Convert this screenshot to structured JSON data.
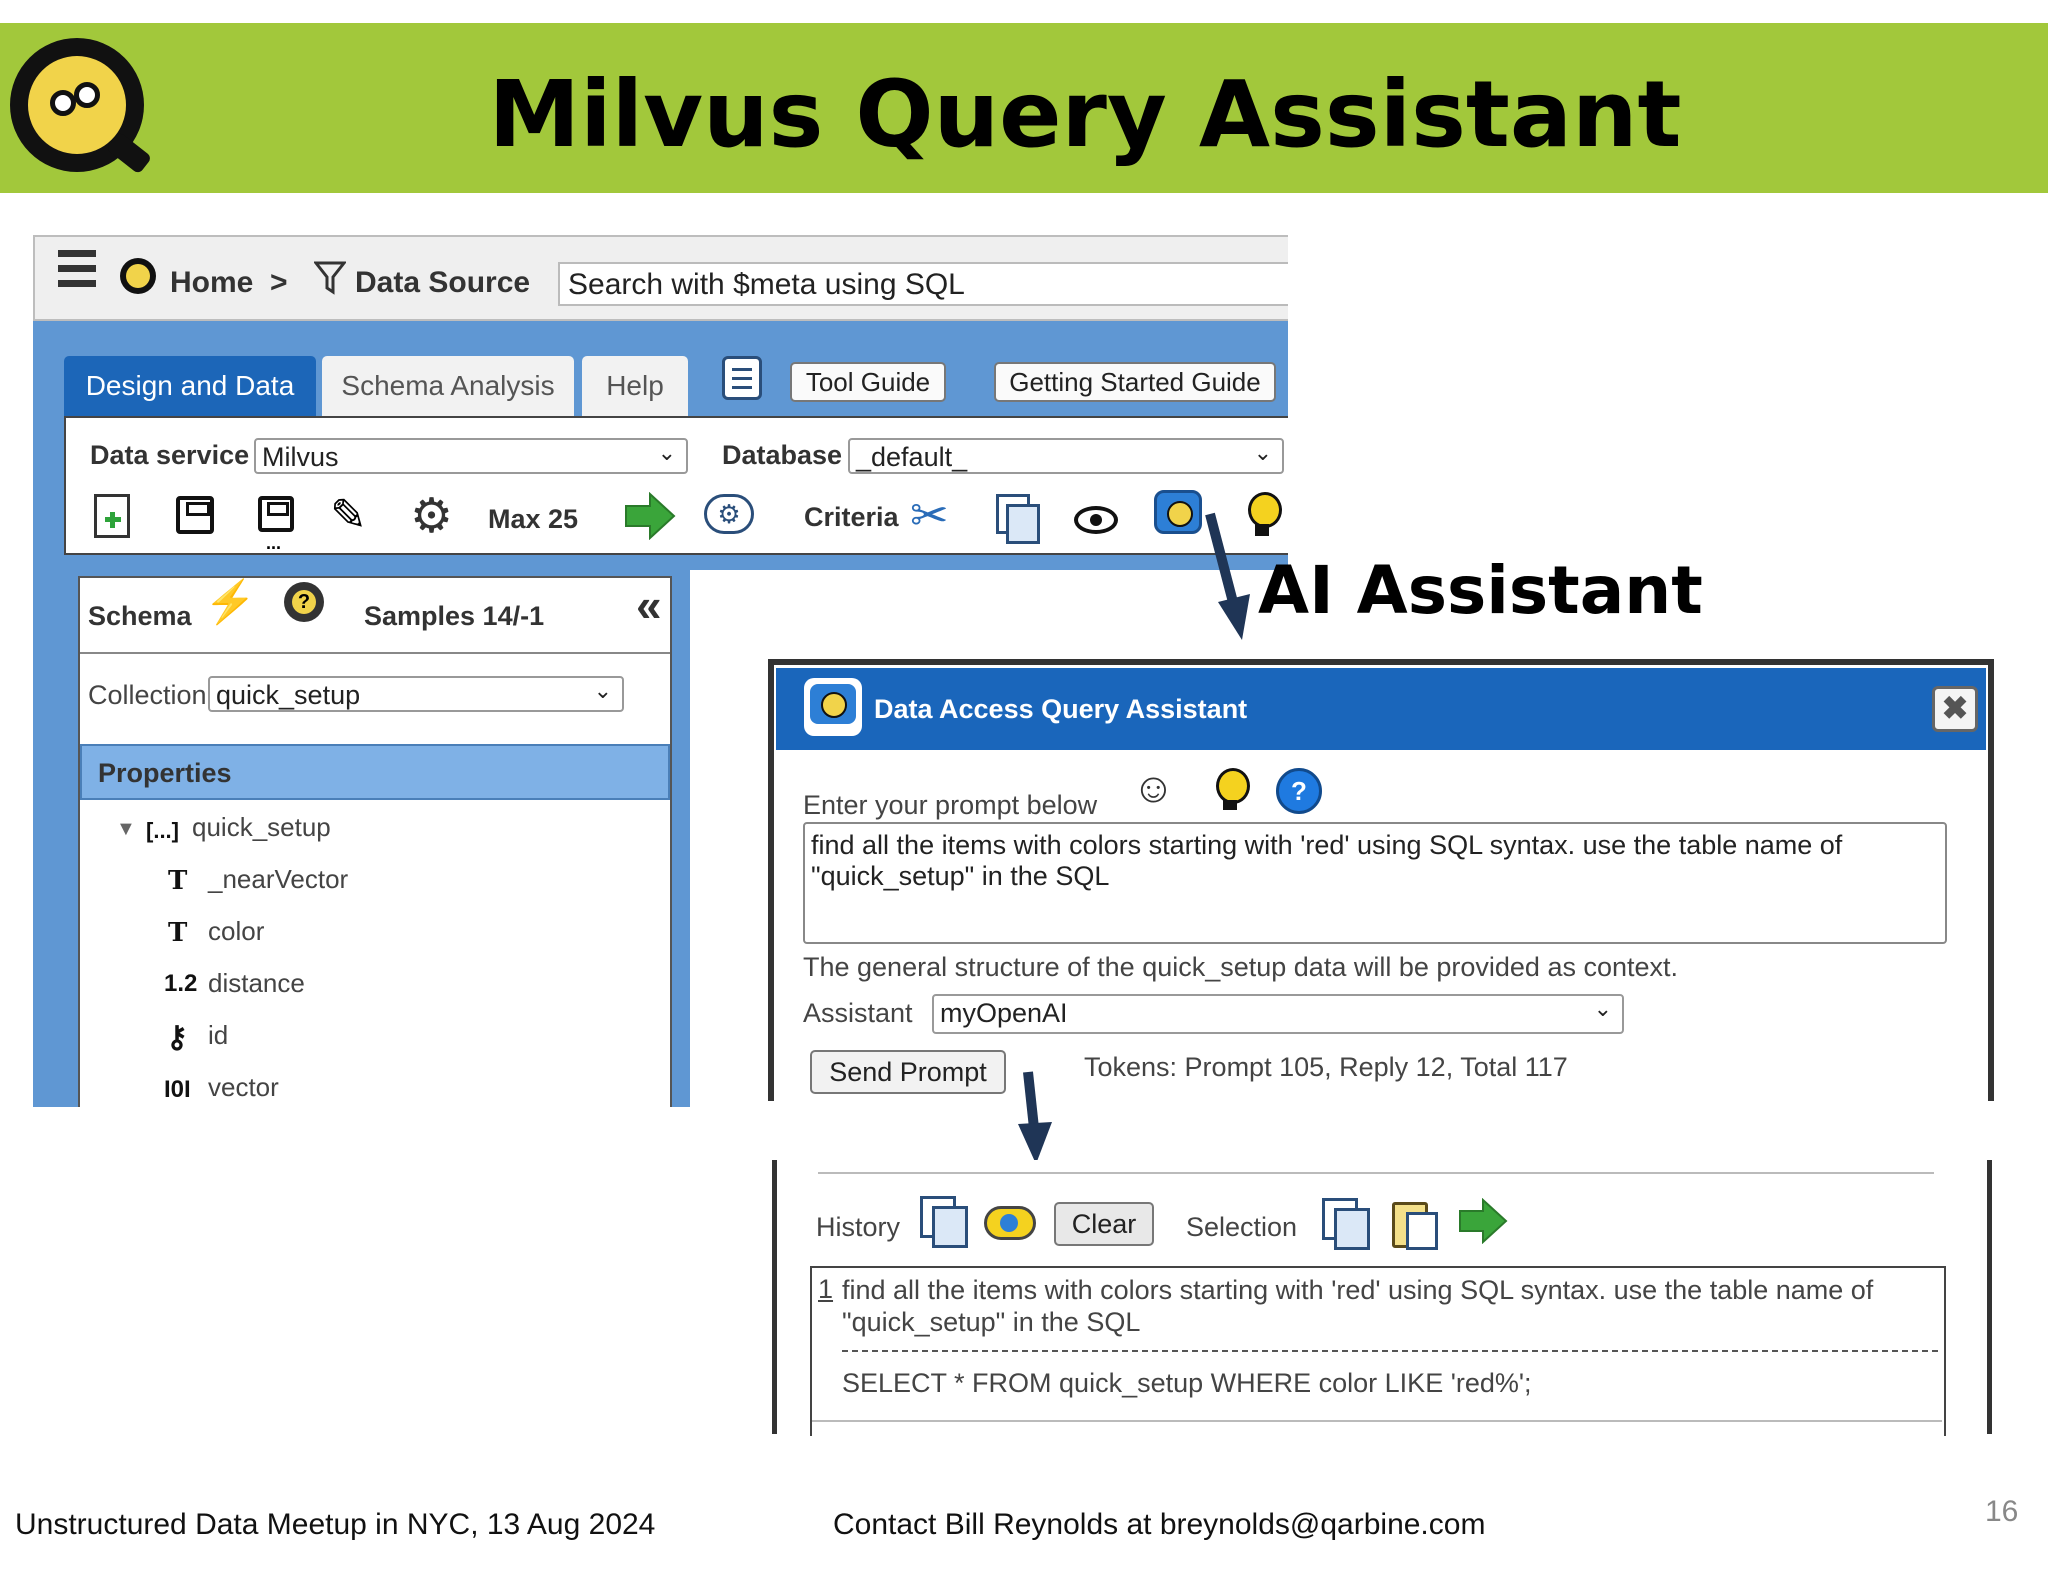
{
  "slide": {
    "title": "Milvus Query Assistant",
    "annotation": "AI Assistant",
    "footer_left": "Unstructured Data Meetup in NYC, 13 Aug 2024",
    "footer_center": "Contact Bill Reynolds at breynolds@qarbine.com",
    "page_number": "16"
  },
  "nav": {
    "home": "Home",
    "separator": ">",
    "data_source": "Data Source",
    "search_value": "Search with $meta using SQL"
  },
  "tabs": [
    "Design and Data",
    "Schema Analysis",
    "Help"
  ],
  "buttons": {
    "tool_guide": "Tool Guide",
    "getting_started": "Getting Started Guide"
  },
  "toolbar": {
    "data_service_label": "Data service",
    "data_service_value": "Milvus",
    "database_label": "Database",
    "database_value": "_default_",
    "max_label": "Max 25",
    "criteria_label": "Criteria"
  },
  "schema": {
    "title": "Schema",
    "samples": "Samples 14/-1",
    "collection_label": "Collection",
    "collection_value": "quick_setup",
    "properties_label": "Properties",
    "root": {
      "icon": "[...]",
      "name": "quick_setup"
    },
    "fields": [
      {
        "icon": "T",
        "name": "_nearVector"
      },
      {
        "icon": "T",
        "name": "color"
      },
      {
        "icon": "1.2",
        "name": "distance"
      },
      {
        "icon": "⚷",
        "name": "id"
      },
      {
        "icon": "I0I",
        "name": "vector"
      }
    ]
  },
  "dialog": {
    "title": "Data Access Query Assistant",
    "prompt_label": "Enter your prompt below",
    "prompt_text": "find all the items with colors starting with 'red' using SQL syntax. use the table name of \"quick_setup\" in the SQL",
    "context_note": "The general structure of the quick_setup data will be provided as context.",
    "assistant_label": "Assistant",
    "assistant_value": "myOpenAI",
    "send_button": "Send Prompt",
    "tokens": "Tokens: Prompt 105, Reply 12, Total 117"
  },
  "history": {
    "label": "History",
    "clear_button": "Clear",
    "selection_label": "Selection",
    "entry_number": "1",
    "entry_prompt": "find all the items with colors starting with 'red' using SQL syntax. use the table name of \"quick_setup\" in the SQL",
    "entry_result": "SELECT * FROM quick_setup WHERE color LIKE 'red%';"
  },
  "colors": {
    "banner": "#a2c83b",
    "tab_active": "#1c66b8",
    "dialog_header": "#1a66bb",
    "frame": "#5f97d3"
  }
}
